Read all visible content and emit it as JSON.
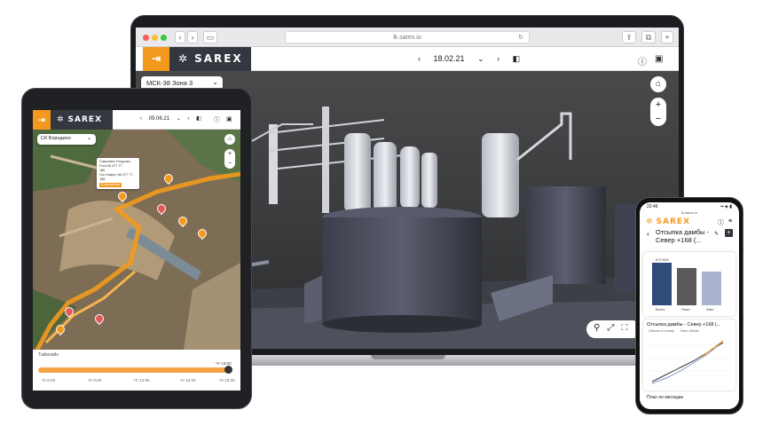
{
  "laptop": {
    "browser": {
      "url": "lk.sarex.io",
      "back": "‹",
      "forward": "›",
      "tabs_icon": "▭",
      "share": "⇪",
      "tabs": "⧉",
      "new_tab": "+",
      "reload": "↻"
    },
    "app": {
      "logout_icon": "⇥",
      "brand": "SAREX",
      "brand_icon": "✲",
      "date": "18.02.21",
      "prev": "‹",
      "next": "›",
      "dropdown": "⌄",
      "compare_icon": "◧",
      "info_icon": "ⓘ",
      "save_icon": "▣"
    },
    "scene": {
      "layer": "МСК-38 Зона 3",
      "layer_chevron": "⌄",
      "home_icon": "⌂",
      "zoom_in": "+",
      "zoom_out": "−",
      "tools": "⚲⤢⛶"
    },
    "colors": {
      "accent": "#f39a1e",
      "brand_bg": "#34373f"
    }
  },
  "tablet": {
    "app": {
      "logout_icon": "⇥",
      "brand": "SAREX",
      "brand_icon": "✲",
      "date": "09.06.21",
      "prev": "‹",
      "next": "›",
      "dropdown": "⌄",
      "compare_icon": "◧",
      "info_icon": "ⓘ",
      "save_icon": "▣"
    },
    "map": {
      "layer": "СК Бородино",
      "layer_chevron": "⌄",
      "home_icon": "⌂",
      "zoom_in": "+",
      "zoom_out": "−"
    },
    "tooltip": {
      "line1": "Самосвал  Погрузка",
      "line2": "Foot:08 477 77",
      "line3": "186",
      "line4": "Гос.Номер: 86 477 77 186",
      "button": "В движении"
    },
    "timeline": {
      "label": "Таймлайн",
      "ticks": [
        "Чт 6:00",
        "Чт 9:00",
        "Чт 12:00",
        "Чт 15:00",
        "Чт 18:00"
      ],
      "end_label": "Чт 18:00"
    }
  },
  "phone": {
    "status": {
      "time": "22:46",
      "url": "lk.sarex.io",
      "signal": "▪▪ ◈ ▮"
    },
    "brand": "SAREX",
    "brand_icon": "✲",
    "info_icon": "ⓘ",
    "menu_icon": "≡",
    "back": "‹",
    "title": "Отсыпка дамбы - Север +168 (...",
    "edit_icon": "✎",
    "add_icon": "+",
    "bar_chart": {
      "values_labels": [
        "670 628",
        "",
        ""
      ],
      "categories": [
        "Всего",
        "План",
        "Факт"
      ],
      "legend": [
        "План",
        "Факт"
      ]
    },
    "line_chart": {
      "title": "Отсыпка дамбы - Север +168 (...",
      "legend": [
        "Объем по плану",
        "Факт объем"
      ]
    },
    "footer": "План по месяцам"
  }
}
